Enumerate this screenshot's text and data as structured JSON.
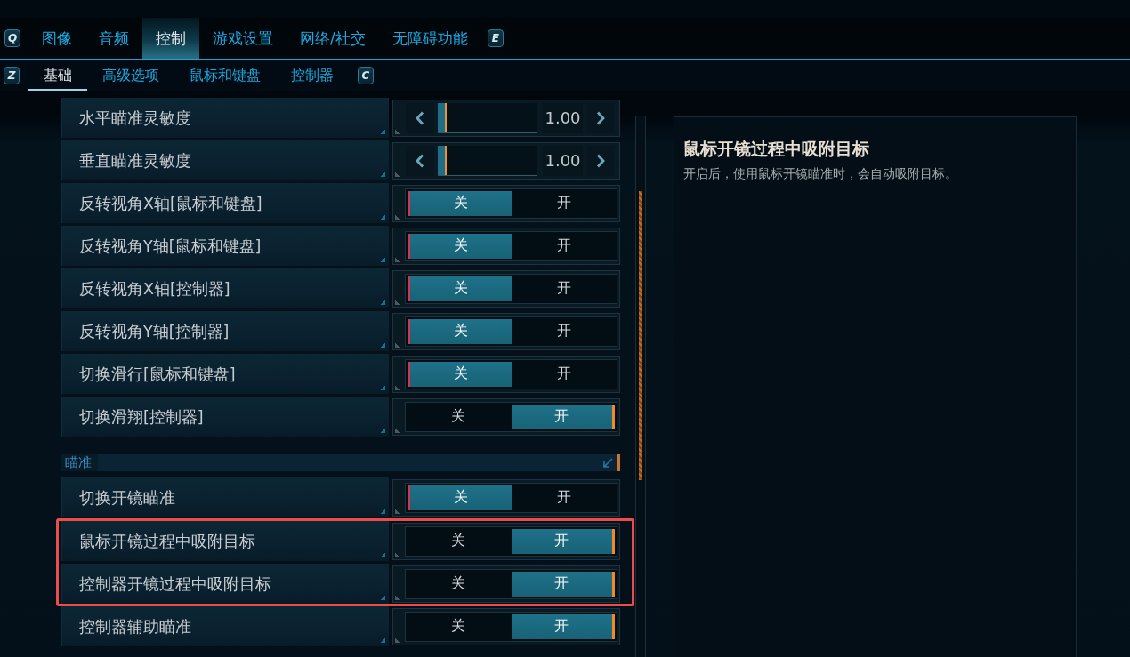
{
  "main_tabs": {
    "prev_key": "Q",
    "items": [
      {
        "label": "图像",
        "selected": false
      },
      {
        "label": "音频",
        "selected": false
      },
      {
        "label": "控制",
        "selected": true
      },
      {
        "label": "游戏设置",
        "selected": false
      },
      {
        "label": "网络/社交",
        "selected": false
      },
      {
        "label": "无障碍功能",
        "selected": false
      }
    ],
    "next_key": "E"
  },
  "sub_tabs": {
    "prev_key": "Z",
    "items": [
      {
        "label": "基础",
        "selected": true
      },
      {
        "label": "高级选项",
        "selected": false
      },
      {
        "label": "鼠标和键盘",
        "selected": false
      },
      {
        "label": "控制器",
        "selected": false
      }
    ],
    "next_key": "C"
  },
  "settings": [
    {
      "kind": "slider",
      "label": "水平瞄准灵敏度",
      "level": 0.09,
      "value": "1.00"
    },
    {
      "kind": "slider",
      "label": "垂直瞄准灵敏度",
      "level": 0.09,
      "value": "1.00"
    },
    {
      "kind": "toggle",
      "label": "反转视角X轴[鼠标和键盘]",
      "options": [
        {
          "label": "关",
          "selected": true
        },
        {
          "label": "开",
          "selected": false
        }
      ]
    },
    {
      "kind": "toggle",
      "label": "反转视角Y轴[鼠标和键盘]",
      "options": [
        {
          "label": "关",
          "selected": true
        },
        {
          "label": "开",
          "selected": false
        }
      ]
    },
    {
      "kind": "toggle",
      "label": "反转视角X轴[控制器]",
      "options": [
        {
          "label": "关",
          "selected": true
        },
        {
          "label": "开",
          "selected": false
        }
      ]
    },
    {
      "kind": "toggle",
      "label": "反转视角Y轴[控制器]",
      "options": [
        {
          "label": "关",
          "selected": true
        },
        {
          "label": "开",
          "selected": false
        }
      ]
    },
    {
      "kind": "toggle",
      "label": "切换滑行[鼠标和键盘]",
      "options": [
        {
          "label": "关",
          "selected": true
        },
        {
          "label": "开",
          "selected": false
        }
      ]
    },
    {
      "kind": "toggle",
      "label": "切换滑翔[控制器]",
      "options": [
        {
          "label": "关",
          "selected": false
        },
        {
          "label": "开",
          "selected": true
        }
      ]
    },
    {
      "kind": "section",
      "label": "瞄准"
    },
    {
      "kind": "toggle",
      "label": "切换开镜瞄准",
      "options": [
        {
          "label": "关",
          "selected": true
        },
        {
          "label": "开",
          "selected": false
        }
      ]
    },
    {
      "kind": "highlight_frame",
      "rows": [
        {
          "kind": "toggle",
          "label": "鼠标开镜过程中吸附目标",
          "options": [
            {
              "label": "关",
              "selected": false
            },
            {
              "label": "开",
              "selected": true
            }
          ]
        },
        {
          "kind": "toggle",
          "label": "控制器开镜过程中吸附目标",
          "options": [
            {
              "label": "关",
              "selected": false
            },
            {
              "label": "开",
              "selected": true
            }
          ]
        }
      ]
    },
    {
      "kind": "toggle",
      "label": "控制器辅助瞄准",
      "options": [
        {
          "label": "关",
          "selected": false
        },
        {
          "label": "开",
          "selected": true
        }
      ]
    }
  ],
  "detail": {
    "title": "鼠标开镜过程中吸附目标",
    "description": "开启后，使用鼠标开镜瞄准时，会自动吸附目标。"
  }
}
